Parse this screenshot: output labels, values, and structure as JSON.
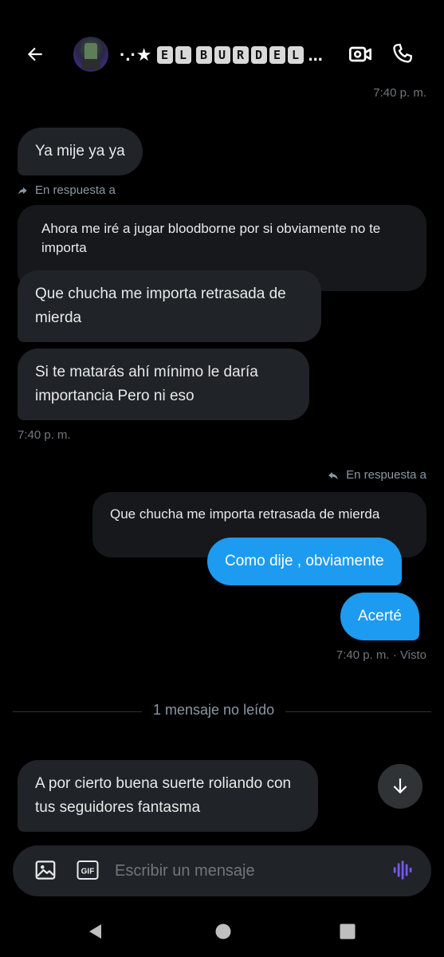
{
  "header": {
    "title_prefix": "·.·★",
    "title_letters": [
      "E",
      "L",
      "B",
      "U",
      "R",
      "D",
      "E",
      "L"
    ],
    "title_suffix": "..."
  },
  "messages": {
    "top_timestamp": "7:40 p. m.",
    "in_1": "Ya mije ya ya",
    "reply_label_in": "En respuesta a",
    "quoted_in": "Ahora me iré a jugar bloodborne por si obviamente no te importa",
    "in_2": "Que chucha me importa retrasada de mierda",
    "in_3": "Si te matarás ahí mínimo le daría importancia Pero ni eso",
    "in_timestamp": "7:40 p. m.",
    "reply_label_out": "En respuesta a",
    "quoted_out": "Que chucha me importa retrasada de mierda",
    "out_1": "Como dije , obviamente",
    "out_2": "Acerté",
    "out_timestamp": "7:40 p. m. · Visto",
    "unread_divider": "1 mensaje no leído",
    "in_4": "A por cierto buena suerte roliando con tus seguidores fantasma"
  },
  "composer": {
    "placeholder": "Escribir un mensaje",
    "gif_label": "GIF"
  },
  "colors": {
    "accent": "#1d9bf0",
    "incoming_bubble": "#202327",
    "voice_icon": "#7856ff"
  }
}
